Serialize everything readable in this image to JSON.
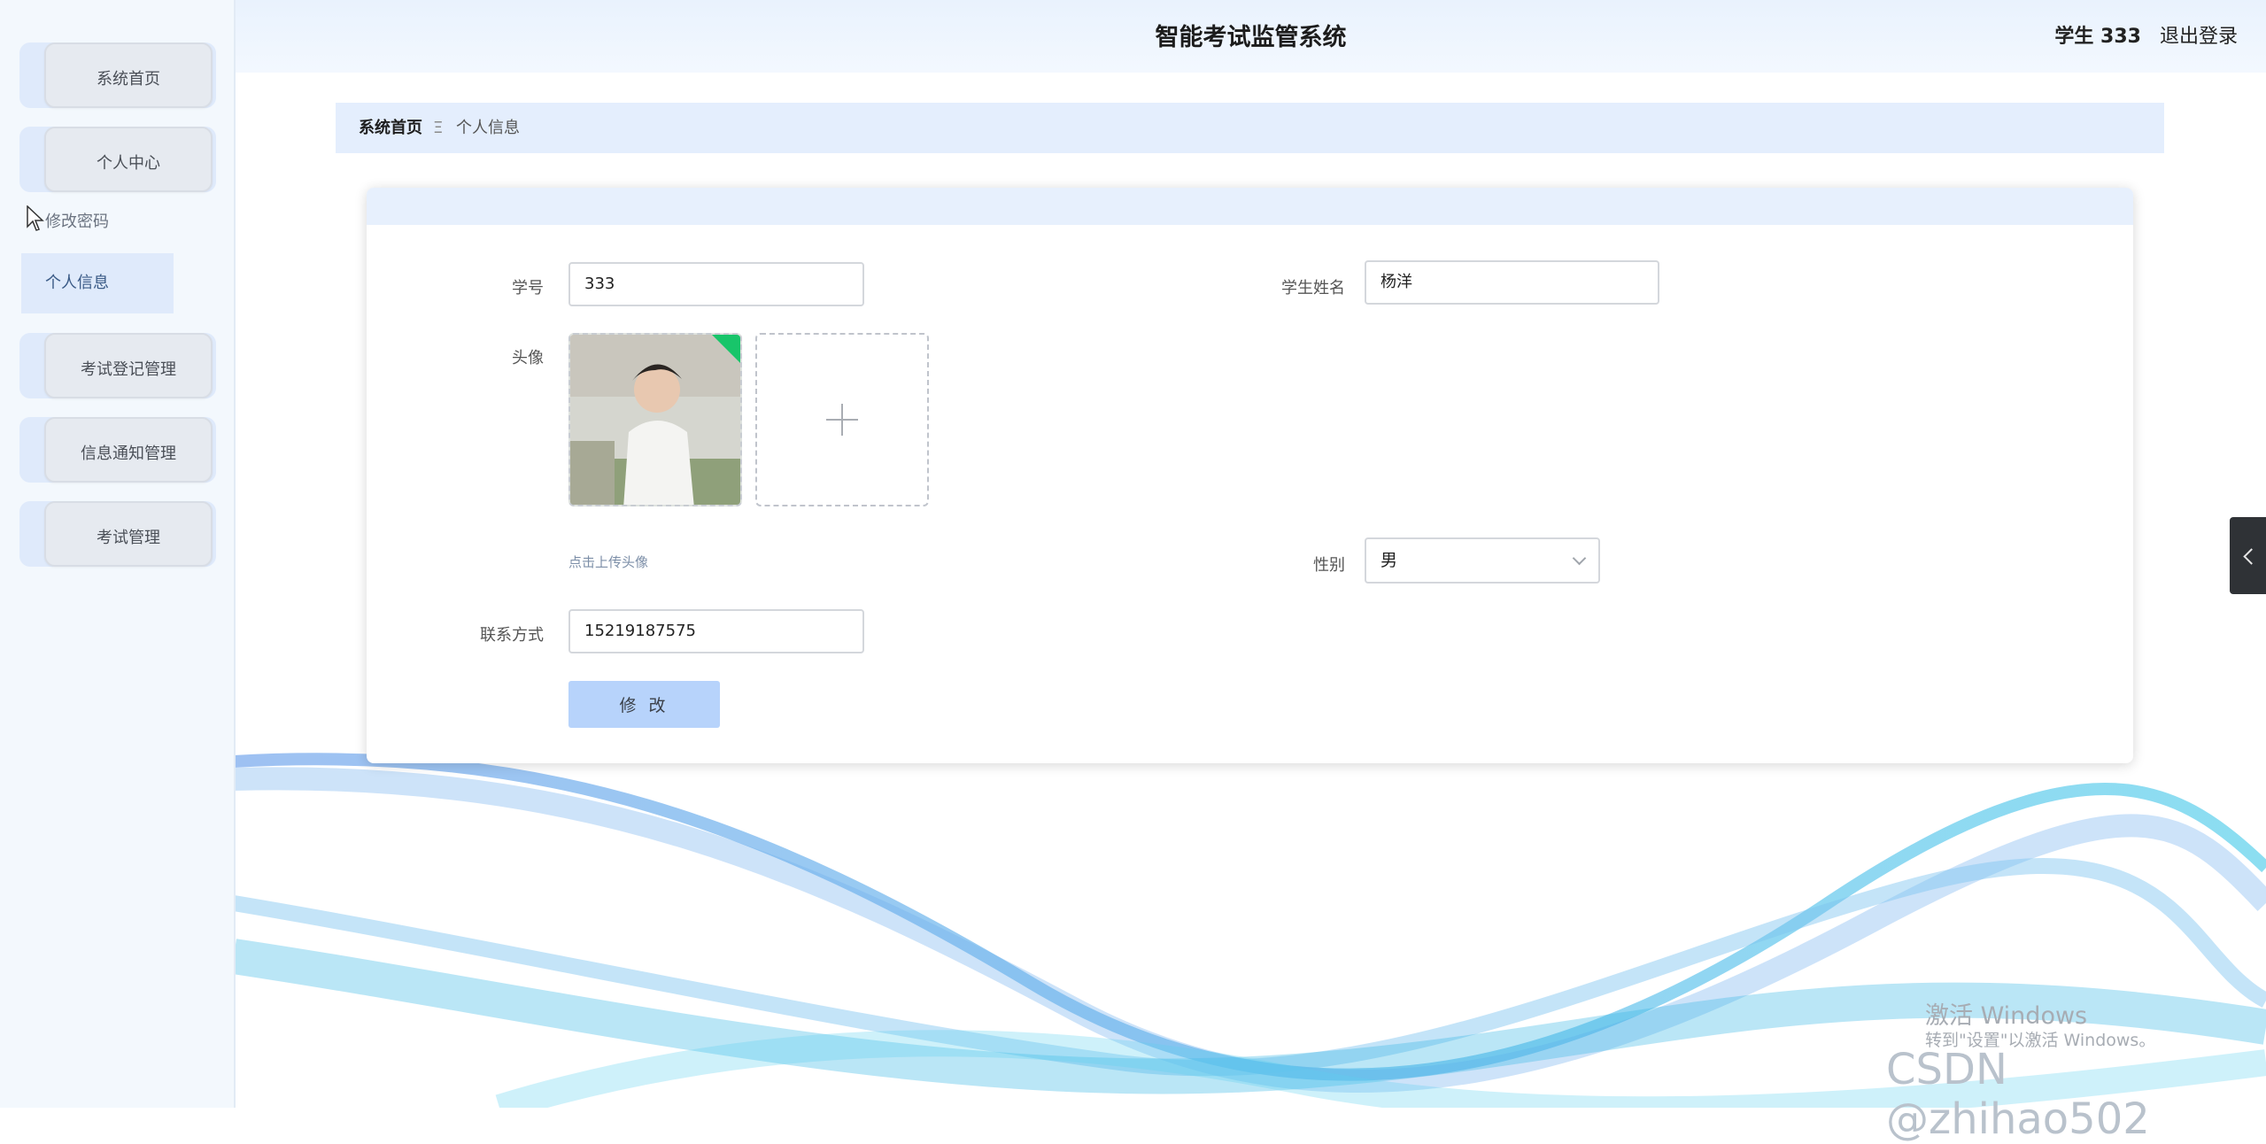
{
  "app": {
    "title": "智能考试监管系统"
  },
  "user": {
    "name": "学生 333",
    "logout": "退出登录"
  },
  "sidebar": {
    "items": [
      {
        "label": "系统首页"
      },
      {
        "label": "个人中心"
      },
      {
        "label": "考试登记管理"
      },
      {
        "label": "信息通知管理"
      },
      {
        "label": "考试管理"
      }
    ],
    "submenu": [
      {
        "label": "修改密码"
      },
      {
        "label": "个人信息"
      }
    ]
  },
  "breadcrumb": {
    "home": "系统首页",
    "separator": "Ξ",
    "current": "个人信息"
  },
  "form": {
    "student_id": {
      "label": "学号",
      "value": "333"
    },
    "student_name": {
      "label": "学生姓名",
      "value": "杨洋"
    },
    "avatar": {
      "label": "头像",
      "tip": "点击上传头像"
    },
    "gender": {
      "label": "性别",
      "value": "男"
    },
    "contact": {
      "label": "联系方式",
      "value": "15219187575"
    },
    "submit_label": "修 改"
  },
  "watermarks": {
    "activate_line1": "激活 Windows",
    "activate_line2": "转到\"设置\"以激活 Windows。",
    "csdn": "CSDN @zhihao502"
  },
  "colors": {
    "accent": "#b7d3fb",
    "sidebar_bg": "#f3f8fd",
    "breadcrumb_bg": "#e4eefd"
  }
}
